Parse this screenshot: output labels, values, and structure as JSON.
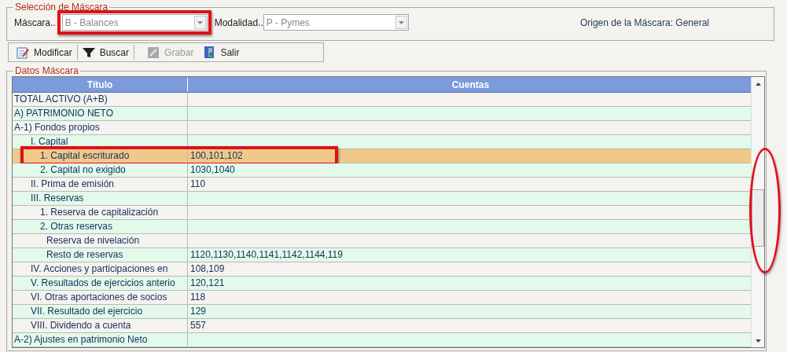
{
  "mask_selection": {
    "legend": "Selección de Máscara",
    "fields": [
      {
        "label": "Máscara..",
        "value": "B - Balances",
        "annotated": true
      },
      {
        "label": "Modalidad..",
        "value": "P - Pymes",
        "annotated": false
      }
    ],
    "origin": "Origen de la Máscara: General"
  },
  "toolbar": [
    {
      "label": "Modificar",
      "kind": "edit",
      "disabled": false
    },
    {
      "label": "Buscar",
      "kind": "filter",
      "disabled": false
    },
    {
      "label": "Grabar",
      "kind": "save",
      "disabled": true
    },
    {
      "label": "Salir",
      "kind": "exit",
      "disabled": false
    }
  ],
  "mask_data": {
    "legend": "Datos Máscara",
    "columns": [
      "Título",
      "Cuentas"
    ],
    "scrollbar_annotated": true,
    "rows": [
      {
        "title": "TOTAL ACTIVO (A+B)",
        "selected": false,
        "annotated": false
      },
      {
        "title": "A) PATRIMONIO NETO",
        "selected": false,
        "annotated": false
      },
      {
        "title": "A-1) Fondos propios",
        "selected": false,
        "annotated": false,
        "children": [
          {
            "title": "I. Capital",
            "selected": false,
            "annotated": false,
            "children": [
              {
                "title": "1. Capital escriturado",
                "accounts": "100,101,102",
                "selected": true,
                "annotated": true
              },
              {
                "title": "2. Capital no exigido",
                "accounts": "1030,1040",
                "selected": false,
                "annotated": false
              }
            ]
          },
          {
            "title": "II. Prima de emisión",
            "accounts": "110",
            "selected": false,
            "annotated": false
          },
          {
            "title": "III. Reservas",
            "selected": false,
            "annotated": false,
            "children": [
              {
                "title": "1. Reserva de capitalización",
                "selected": false,
                "annotated": false
              },
              {
                "title": "2. Otras reservas",
                "selected": false,
                "annotated": false,
                "children": [
                  {
                    "title": "Reserva de nivelación",
                    "selected": false,
                    "annotated": false
                  },
                  {
                    "title": "Resto de reservas",
                    "accounts": "1120,1130,1140,1141,1142,1144,119",
                    "selected": false,
                    "annotated": false
                  }
                ]
              }
            ]
          },
          {
            "title": "IV. Acciones y participaciones en",
            "accounts": "108,109",
            "selected": false,
            "annotated": false
          },
          {
            "title": "V. Resultados de ejercicios anterio",
            "accounts": "120,121",
            "selected": false,
            "annotated": false
          },
          {
            "title": "VI. Otras aportaciones de socios",
            "accounts": "118",
            "selected": false,
            "annotated": false
          },
          {
            "title": "VII. Resultado del ejercicio",
            "accounts": "129",
            "selected": false,
            "annotated": false
          },
          {
            "title": "VIII. Dividendo a cuenta",
            "accounts": "557",
            "selected": false,
            "annotated": false
          }
        ]
      },
      {
        "title": "A-2) Ajustes en patrimonio Neto",
        "selected": false,
        "annotated": false
      }
    ]
  }
}
